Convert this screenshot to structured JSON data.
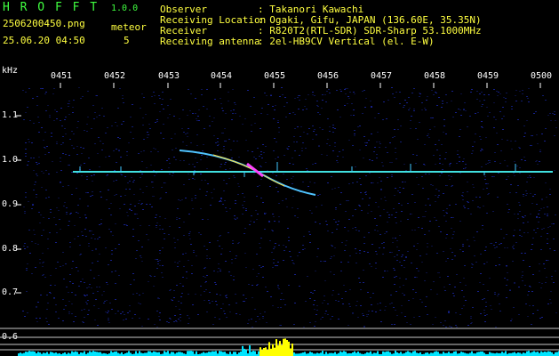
{
  "app": {
    "name": "H R O F F T",
    "version": "1.0.0",
    "filename": "2506200450.png",
    "datetime": "25.06.20 04:50",
    "meteor_label": "meteor",
    "meteor_count": "5"
  },
  "info": {
    "observer_label": "Observer",
    "observer_value": ": Takanori Kawachi",
    "location_label": "Receiving Location",
    "location_value": ": Ogaki, Gifu, JAPAN (136.60E, 35.35N)",
    "receiver_label": "Receiver",
    "receiver_value": ": R820T2(RTL-SDR) SDR-Sharp 53.1000MHz",
    "antenna_label": "Receiving antenna",
    "antenna_value": ": 2el-HB9CV Vertical (el. E-W)"
  },
  "axes": {
    "y_unit": "kHz",
    "x_ticks": [
      "0451",
      "0452",
      "0453",
      "0454",
      "0455",
      "0456",
      "0457",
      "0458",
      "0459",
      "0500"
    ],
    "y_ticks": [
      "1.1",
      "1.0",
      "0.9",
      "0.8",
      "0.7",
      "0.6"
    ]
  },
  "colors": {
    "background": "#000000",
    "carrier": "#40e0e0",
    "meteor_trail": "#4fc3ff",
    "meteor_head": "#ff40ff",
    "noise": "#101a60",
    "level_bar": "#00e5ff",
    "level_peak": "#ffff00"
  }
}
